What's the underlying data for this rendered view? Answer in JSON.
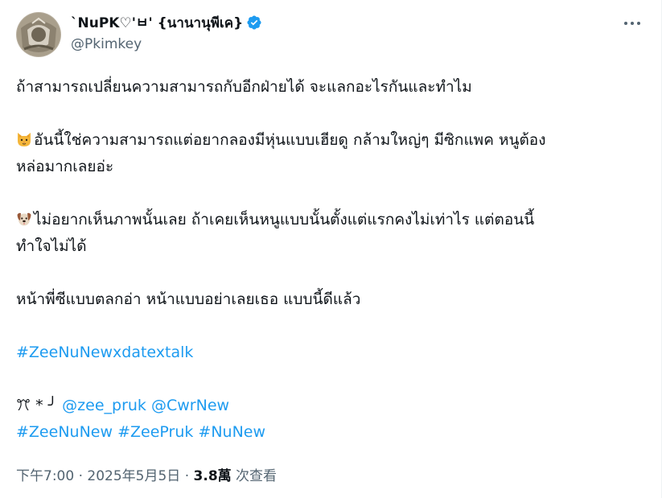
{
  "author": {
    "display_name": "`NuPK♡'ㅂ' {นานานุพีเค}",
    "handle": "@Pkimkey",
    "verified": true
  },
  "tweet": {
    "line1": "ถ้าสามารถเปลี่ยนความสามารถกับอีกฝ่ายได้ จะแลกอะไรกันและทำไม",
    "cat_line1": "อันนี้ใช่ความสามารถแต่อยากลองมีหุ่นแบบเฮียดู กล้ามใหญ่ๆ มีซิกแพค หนูต้อง",
    "cat_line2": "หล่อมากเลยอ่ะ",
    "dog_line1": "ไม่อยากเห็นภาพนั้นเลย ถ้าเคยเห็นหนูแบบนั้นตั้งแต่แรกคงไม่เท่าไร แต่ตอนนี้",
    "dog_line2": "ทำใจไม่ได้",
    "line_face": "หน้าพี่ซีแบบตลกอ่า หน้าแบบอย่าเลยเธอ แบบนี้ดีแล้ว",
    "hashtag_main": "#ZeeNuNewxdatextalk",
    "kaomoji": "ꔫ * ╯",
    "mentions": [
      "@zee_pruk",
      "@CwrNew"
    ],
    "hashtags": [
      "#ZeeNuNew",
      "#ZeePruk",
      "#NuNew"
    ]
  },
  "emojis": {
    "first": "cat-face-icon",
    "second": "dog-face-icon"
  },
  "meta": {
    "time": "下午7:00",
    "separator": " · ",
    "date": "2025年5月5日",
    "views_count": "3.8萬",
    "views_label": " 次查看"
  },
  "colors": {
    "link": "#1d9bf0",
    "text": "#0f1419",
    "secondary": "#536471"
  }
}
